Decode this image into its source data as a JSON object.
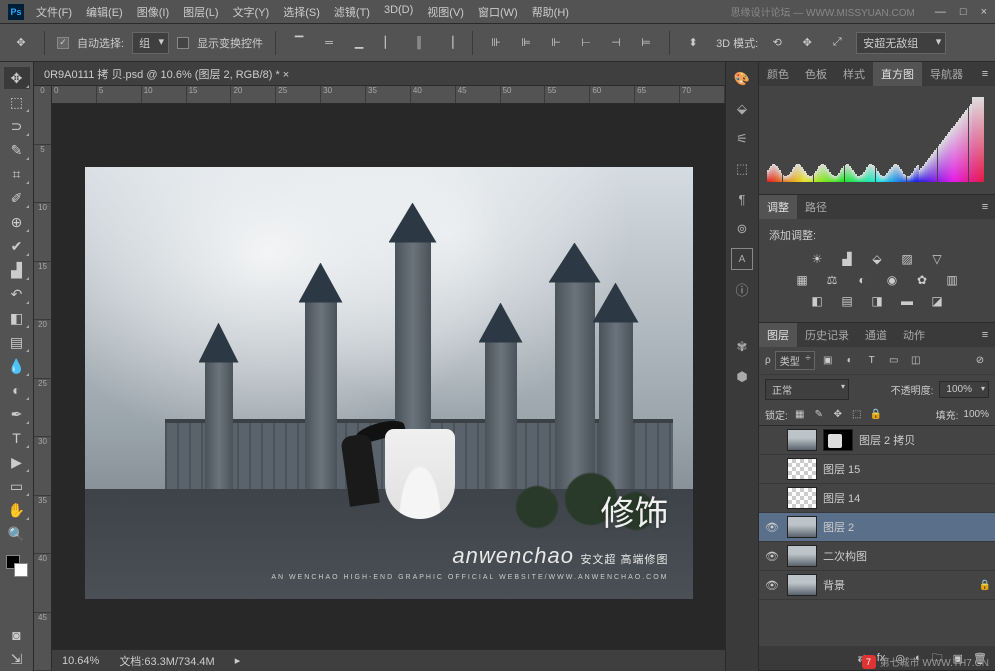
{
  "titlebar": {
    "menus": [
      "文件(F)",
      "编辑(E)",
      "图像(I)",
      "图层(L)",
      "文字(Y)",
      "选择(S)",
      "滤镜(T)",
      "3D(D)",
      "视图(V)",
      "窗口(W)",
      "帮助(H)"
    ],
    "rightText": "思缘设计论坛 — WWW.MISSYUAN.COM"
  },
  "options": {
    "autoSelect": "自动选择:",
    "group": "组",
    "showTransform": "显示变换控件",
    "mode3d": "3D 模式:",
    "preset": "安超无敌组"
  },
  "doc": {
    "tab": "0R9A0111 拷 贝.psd @ 10.6% (图层 2, RGB/8) * ×",
    "rulerH": [
      "0",
      "5",
      "10",
      "15",
      "20",
      "25",
      "30",
      "35",
      "40",
      "45",
      "50",
      "55",
      "60",
      "65",
      "70"
    ],
    "rulerV": [
      "0",
      "5",
      "10",
      "15",
      "20",
      "25",
      "30",
      "35",
      "40",
      "45"
    ]
  },
  "watermark": {
    "big": "修饰",
    "script": "anwenchao",
    "sub": "安文超 高端修图",
    "tiny": "AN WENCHAO HIGH-END GRAPHIC  OFFICIAL WEBSITE/WWW.ANWENCHAO.COM"
  },
  "status": {
    "zoom": "10.64%",
    "docinfo": "文档:63.3M/734.4M"
  },
  "panels": {
    "colorTabs": [
      "颜色",
      "色板",
      "样式",
      "直方图",
      "导航器"
    ],
    "adjTabs": [
      "调整",
      "路径"
    ],
    "adjTitle": "添加调整:",
    "layerTabs": [
      "图层",
      "历史记录",
      "通道",
      "动作"
    ],
    "filterLabel": "类型",
    "blendMode": "正常",
    "opacityLabel": "不透明度:",
    "opacity": "100%",
    "lockLabel": "锁定:",
    "fillLabel": "填充:",
    "fill": "100%"
  },
  "layers": [
    {
      "eye": "",
      "name": "图层 2 拷贝",
      "thumb": "img",
      "mask": true,
      "sel": false
    },
    {
      "eye": "",
      "name": "图层 15",
      "thumb": "trans",
      "mask": false,
      "sel": false
    },
    {
      "eye": "",
      "name": "图层 14",
      "thumb": "trans",
      "mask": false,
      "sel": false
    },
    {
      "eye": "👁",
      "name": "图层 2",
      "thumb": "img",
      "mask": false,
      "sel": true
    },
    {
      "eye": "👁",
      "name": "二次构图",
      "thumb": "img",
      "mask": false,
      "sel": false
    },
    {
      "eye": "👁",
      "name": "背景",
      "thumb": "img",
      "mask": false,
      "sel": false,
      "lock": "🔒"
    }
  ],
  "bottomWm": "第七城市  WWW.TH7.CN"
}
